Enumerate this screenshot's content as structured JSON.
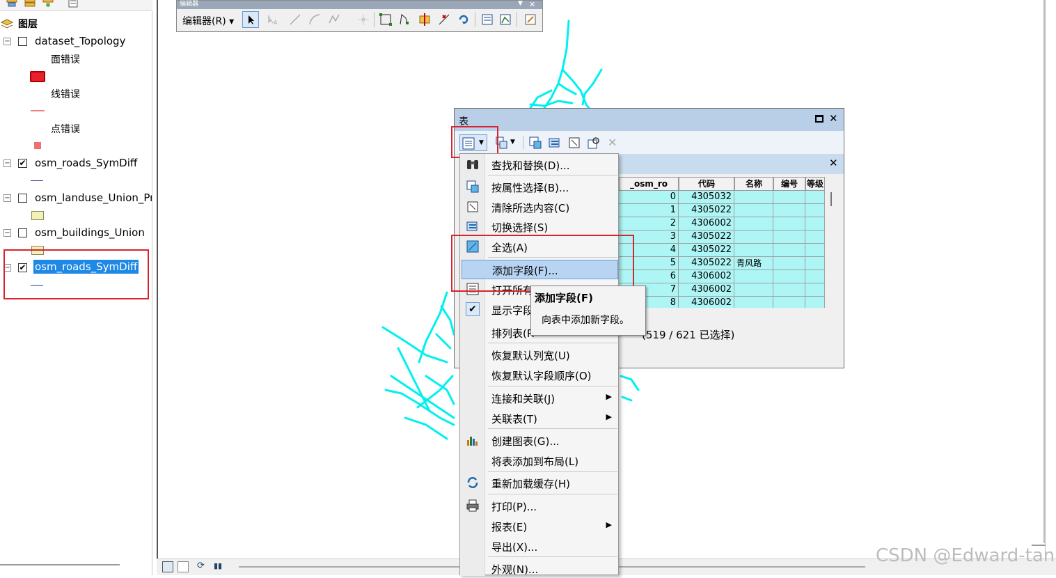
{
  "toc": {
    "title": "图层",
    "layers": [
      {
        "name": "dataset_Topology",
        "checked": false
      },
      {
        "name": "osm_roads_SymDiff",
        "checked": true
      },
      {
        "name": "osm_landuse_Union_Pr",
        "checked": false
      },
      {
        "name": "osm_buildings_Union",
        "checked": false
      },
      {
        "name": "osm_roads_SymDiff",
        "checked": true
      }
    ],
    "topology_sublayers": [
      "面错误",
      "线错误",
      "点错误"
    ],
    "check_mark": "✔",
    "expander_symbol": "⊟"
  },
  "editor_toolbar": {
    "title": "编辑器",
    "menu_label": "编辑器(R) ▾"
  },
  "table_window": {
    "title": "表",
    "status_text": "(519 / 621 已选择)",
    "columns": [
      "_osm_ro",
      "代码",
      "名称",
      "编号",
      "等级"
    ],
    "rows": [
      {
        "id": "0",
        "code": "4305032",
        "name": ""
      },
      {
        "id": "1",
        "code": "4305022",
        "name": ""
      },
      {
        "id": "2",
        "code": "4306002",
        "name": ""
      },
      {
        "id": "3",
        "code": "4305022",
        "name": ""
      },
      {
        "id": "4",
        "code": "4305022",
        "name": ""
      },
      {
        "id": "5",
        "code": "4305022",
        "name": "青风路"
      },
      {
        "id": "6",
        "code": "4306002",
        "name": ""
      },
      {
        "id": "7",
        "code": "4306002",
        "name": ""
      },
      {
        "id": "8",
        "code": "4306002",
        "name": ""
      }
    ]
  },
  "menu": {
    "items": [
      {
        "label": "查找和替换(D)...",
        "icon": "binoculars-icon"
      },
      {
        "label": "按属性选择(B)...",
        "icon": "select-by-attributes-icon"
      },
      {
        "label": "清除所选内容(C)",
        "icon": "clear-selection-icon"
      },
      {
        "label": "切换选择(S)",
        "icon": "switch-selection-icon"
      },
      {
        "label": "全选(A)",
        "icon": "select-all-icon"
      },
      {
        "label": "添加字段(F)...",
        "icon": ""
      },
      {
        "label": "打开所有",
        "icon": "open-all-icon"
      },
      {
        "label": "显示字段",
        "icon": "checkmark-icon"
      },
      {
        "label": "排列表(R",
        "icon": ""
      },
      {
        "label": "恢复默认列宽(U)",
        "icon": ""
      },
      {
        "label": "恢复默认字段顺序(O)",
        "icon": ""
      },
      {
        "label": "连接和关联(J)",
        "icon": ""
      },
      {
        "label": "关联表(T)",
        "icon": ""
      },
      {
        "label": "创建图表(G)...",
        "icon": "chart-icon"
      },
      {
        "label": "将表添加到布局(L)",
        "icon": ""
      },
      {
        "label": "重新加载缓存(H)",
        "icon": "reload-icon"
      },
      {
        "label": "打印(P)...",
        "icon": "printer-icon"
      },
      {
        "label": "报表(E)",
        "icon": ""
      },
      {
        "label": "导出(X)...",
        "icon": ""
      },
      {
        "label": "外观(N)...",
        "icon": ""
      }
    ],
    "submenu_arrow": "▶"
  },
  "tooltip": {
    "title": "添加字段(F)",
    "description": "向表中添加新字段。"
  },
  "watermark": "CSDN @Edward-tan",
  "colors": {
    "roads": "#00f0f0",
    "selection": "#aef5f5",
    "highlight": "#1e88e5",
    "menu_hover": "#b7d4f2",
    "annotation_red": "#d9232e"
  }
}
